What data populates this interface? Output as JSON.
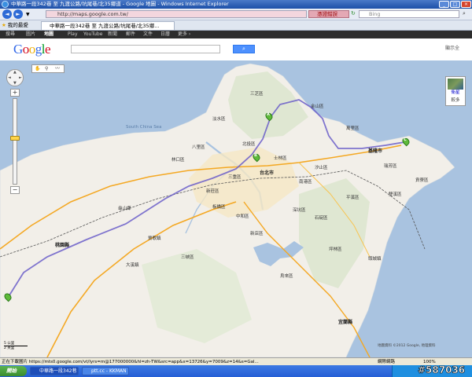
{
  "window": {
    "title": "中華路一段342巷 至 九渡公路/坑尾巷/北35鄉道 - Google 地圖 - Windows Internet Explorer"
  },
  "addressbar": {
    "url": "http://maps.google.com.tw/",
    "cert_error": "憑證錯誤",
    "search_placeholder": "Bing"
  },
  "tabs": {
    "favorites": "我的最愛",
    "active_tab": "中華路一段342巷 至 九渡公路/坑尾巷/北35鄉..."
  },
  "google_nav": {
    "items": [
      "搜尋",
      "圖片",
      "地圖",
      "Play",
      "YouTube",
      "新聞",
      "郵件",
      "文件",
      "日曆",
      "更多 ›"
    ]
  },
  "header": {
    "logo_text": "Google",
    "account_label": "顯示全"
  },
  "map_controls": {
    "zoom_in": "+",
    "zoom_out": "−",
    "satellite_label": "衛星",
    "more_label": "較多"
  },
  "map_labels": [
    {
      "text": "淡水區",
      "pos": "a"
    },
    {
      "text": "三芝區",
      "pos": "b"
    },
    {
      "text": "金山區",
      "pos": "c"
    },
    {
      "text": "萬里區",
      "pos": "d"
    },
    {
      "text": "北投區",
      "pos": "e"
    },
    {
      "text": "士林區",
      "pos": "f"
    },
    {
      "text": "台北市",
      "pos": "g"
    },
    {
      "text": "三重區",
      "pos": "h"
    },
    {
      "text": "新莊區",
      "pos": "i"
    },
    {
      "text": "板橋區",
      "pos": "j"
    },
    {
      "text": "中和區",
      "pos": "k"
    },
    {
      "text": "新店區",
      "pos": "l"
    },
    {
      "text": "汐止區",
      "pos": "m"
    },
    {
      "text": "基隆市",
      "pos": "n"
    },
    {
      "text": "瑞芳區",
      "pos": "o"
    },
    {
      "text": "平溪區",
      "pos": "p"
    },
    {
      "text": "雙溪區",
      "pos": "q"
    },
    {
      "text": "貢寮區",
      "pos": "r"
    },
    {
      "text": "桃園縣",
      "pos": "s"
    },
    {
      "text": "龜山鄉",
      "pos": "t"
    },
    {
      "text": "鶯歌鎮",
      "pos": "u"
    },
    {
      "text": "三峽區",
      "pos": "v"
    },
    {
      "text": "烏來區",
      "pos": "w"
    },
    {
      "text": "坪林區",
      "pos": "x"
    },
    {
      "text": "大溪鎮",
      "pos": "y"
    },
    {
      "text": "八里區",
      "pos": "z"
    },
    {
      "text": "南港區",
      "pos": "aa"
    },
    {
      "text": "深坑區",
      "pos": "bb"
    },
    {
      "text": "石碇區",
      "pos": "cc"
    },
    {
      "text": "林口區",
      "pos": "dd"
    },
    {
      "text": "頭城鎮",
      "pos": "ee"
    },
    {
      "text": "宜蘭縣",
      "pos": "ff"
    }
  ],
  "sea_labels": [
    "South China Sea"
  ],
  "markers": [
    "A",
    "B",
    "C"
  ],
  "map_footer": {
    "copyright": "地圖資料 ©2012 Google, 地理資料",
    "scale_top": "5 公里",
    "scale_bottom": "2 英里"
  },
  "statusbar": {
    "text": "正在下載圖片 https://mts0.google.com/vt/lyrs=m@177000000&hl=zh-TW&src=app&x=13726&y=7009&z=14&s=Gal...",
    "zone": "網際網路",
    "zoom": "100%"
  },
  "taskbar": {
    "start_label": "開始",
    "tasks": [
      "中華路一段342巷 至 九...",
      "ptt.cc - KKMAN"
    ]
  },
  "watermark": "#587036",
  "colors": {
    "water": "#a9c3e0",
    "land": "#f2efe9",
    "route": "#6b5ec9",
    "highway": "#f4a823",
    "marker": "#5fba3a"
  }
}
